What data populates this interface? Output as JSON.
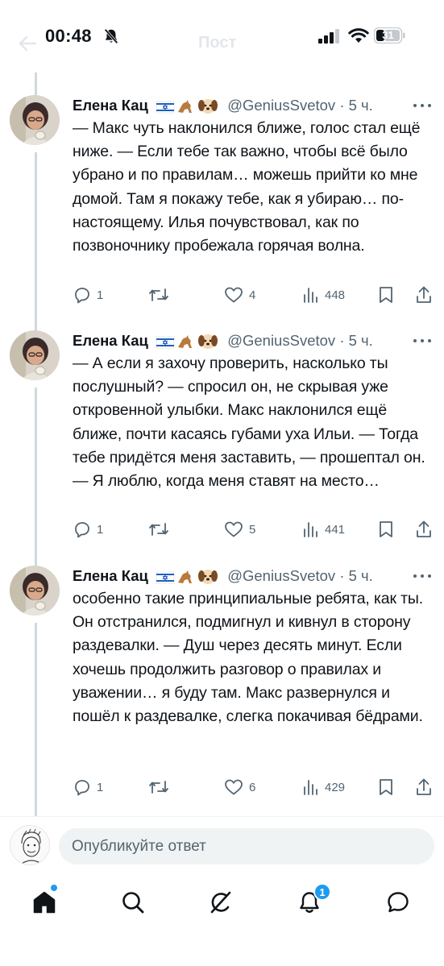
{
  "status_bar": {
    "time": "00:48",
    "battery": "31"
  },
  "header": {
    "title": "Пост"
  },
  "colors": {
    "accent": "#1d9bf0",
    "text": "#0f1419",
    "secondary": "#536471",
    "thread_line": "#cfd9de"
  },
  "tweets": [
    {
      "name": "Елена Кац",
      "handle": "@GeniusSvetov",
      "time": "· 5 ч.",
      "text": "— Макс чуть наклонился ближе, голос стал ещё ниже. — Если тебе так важно, чтобы всё было убрано и по правилам… можешь прийти ко мне домой. Там я покажу тебе, как я убираю… по-настоящему. Илья почувствовал, как по позвоночнику пробежала горячая волна.",
      "replies": "1",
      "reposts": "",
      "likes": "4",
      "views": "448"
    },
    {
      "name": "Елена Кац",
      "handle": "@GeniusSvetov",
      "time": "· 5 ч.",
      "text": "— А если я захочу проверить, насколько ты послушный? — спросил он, не скрывая уже откровенной улыбки. Макс наклонился ещё ближе, почти касаясь губами уха Ильи. — Тогда тебе придётся меня заставить, — прошептал он. — Я люблю, когда меня ставят на место…",
      "replies": "1",
      "reposts": "",
      "likes": "5",
      "views": "441"
    },
    {
      "name": "Елена Кац",
      "handle": "@GeniusSvetov",
      "time": "· 5 ч.",
      "text": "особенно такие принципиальные ребята, как ты. Он отстранился, подмигнул и кивнул в сторону раздевалки. — Душ через десять минут. Если хочешь продолжить разговор о правилах и уважении… я буду там. Макс развернулся и пошёл к раздевалке, слегка покачивая бёдрами.",
      "replies": "1",
      "reposts": "",
      "likes": "6",
      "views": "429"
    }
  ],
  "reply_bar": {
    "placeholder": "Опубликуйте ответ"
  },
  "bottom_nav": {
    "items": [
      "home-icon",
      "search-icon",
      "grok-icon",
      "notifications-icon",
      "messages-icon"
    ],
    "notifications_badge": "1"
  }
}
